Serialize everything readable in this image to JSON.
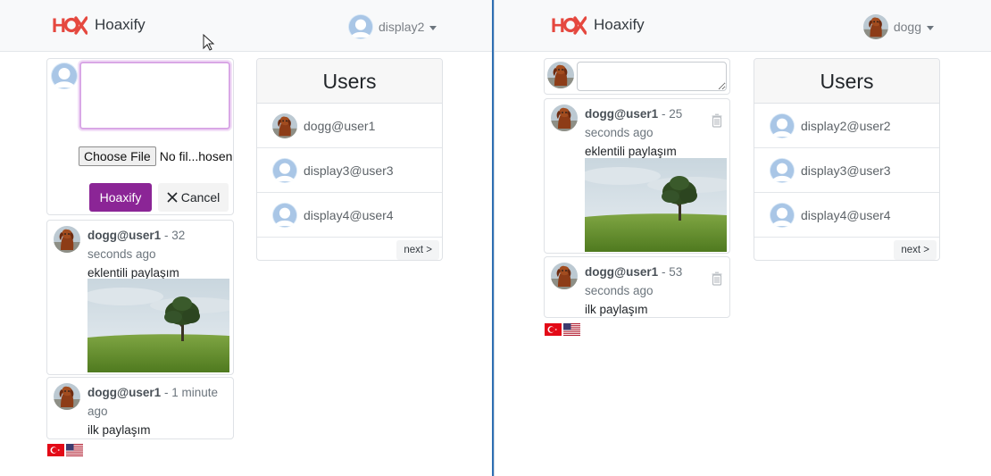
{
  "left": {
    "brand": "Hoaxify",
    "nav_user": "display2",
    "composer": {
      "textarea_value": "",
      "choose_file_label": "Choose File",
      "file_name": "No fil...hosen",
      "submit_label": "Hoaxify",
      "cancel_label": "Cancel"
    },
    "posts": [
      {
        "user": "dogg@user1",
        "time": "32 seconds ago",
        "content": "eklentili paylaşım",
        "has_image": true
      },
      {
        "user": "dogg@user1",
        "time": "1 minute ago",
        "content": "ilk paylaşım",
        "has_image": false
      }
    ],
    "users_title": "Users",
    "users": [
      "dogg@user1",
      "display3@user3",
      "display4@user4"
    ],
    "next_label": "next >"
  },
  "right": {
    "brand": "Hoaxify",
    "nav_user": "dogg",
    "composer": {
      "textarea_value": ""
    },
    "posts": [
      {
        "user": "dogg@user1",
        "time": "25 seconds ago",
        "content": "eklentili paylaşım",
        "has_image": true
      },
      {
        "user": "dogg@user1",
        "time": "53 seconds ago",
        "content": "ilk paylaşım",
        "has_image": false
      }
    ],
    "users_title": "Users",
    "users": [
      "display2@user2",
      "display3@user3",
      "display4@user4"
    ],
    "next_label": "next >"
  },
  "icons": {
    "logo": "hoaxify-logo-icon",
    "default_avatar": "default-avatar-icon",
    "dog_avatar": "dog-avatar-icon",
    "delete": "trash-icon",
    "cancel": "close-icon",
    "flag_tr": "turkey-flag-icon",
    "flag_us": "usa-flag-icon"
  },
  "colors": {
    "primary": "#8b2596",
    "navbar_bg": "#f8f9fa",
    "textarea_focus": "#d9a7e6",
    "logo_red": "#e5483f"
  }
}
